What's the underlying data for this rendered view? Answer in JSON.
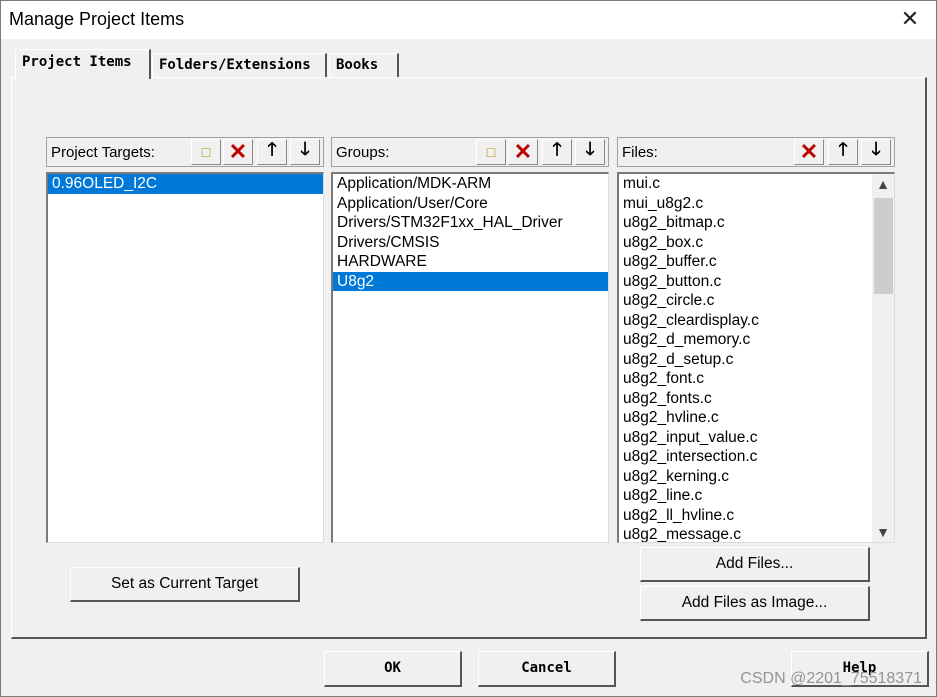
{
  "window": {
    "title": "Manage Project Items",
    "close_symbol": "✕"
  },
  "tabs": [
    {
      "label": "Project Items",
      "active": true
    },
    {
      "label": "Folders/Extensions",
      "active": false
    },
    {
      "label": "Books",
      "active": false
    }
  ],
  "targets": {
    "header": "Project Targets:",
    "items": [
      "0.96OLED_I2C"
    ],
    "selected": "0.96OLED_I2C"
  },
  "groups": {
    "header": "Groups:",
    "items": [
      "Application/MDK-ARM",
      "Application/User/Core",
      "Drivers/STM32F1xx_HAL_Driver",
      "Drivers/CMSIS",
      "HARDWARE",
      "U8g2"
    ],
    "selected": "U8g2"
  },
  "files": {
    "header": "Files:",
    "items": [
      "mui.c",
      "mui_u8g2.c",
      "u8g2_bitmap.c",
      "u8g2_box.c",
      "u8g2_buffer.c",
      "u8g2_button.c",
      "u8g2_circle.c",
      "u8g2_cleardisplay.c",
      "u8g2_d_memory.c",
      "u8g2_d_setup.c",
      "u8g2_font.c",
      "u8g2_fonts.c",
      "u8g2_hvline.c",
      "u8g2_input_value.c",
      "u8g2_intersection.c",
      "u8g2_kerning.c",
      "u8g2_line.c",
      "u8g2_ll_hvline.c",
      "u8g2_message.c"
    ]
  },
  "buttons": {
    "set_current_target": "Set as Current Target",
    "add_files": "Add Files...",
    "add_files_image": "Add Files as Image...",
    "ok": "OK",
    "cancel": "Cancel",
    "help": "Help"
  },
  "watermark": "CSDN @2201_75518371",
  "icons": {
    "new": "new-item-icon",
    "delete": "delete-icon",
    "up": "move-up-icon",
    "down": "move-down-icon"
  },
  "colors": {
    "selection": "#0078d7",
    "delete": "#c00000"
  }
}
